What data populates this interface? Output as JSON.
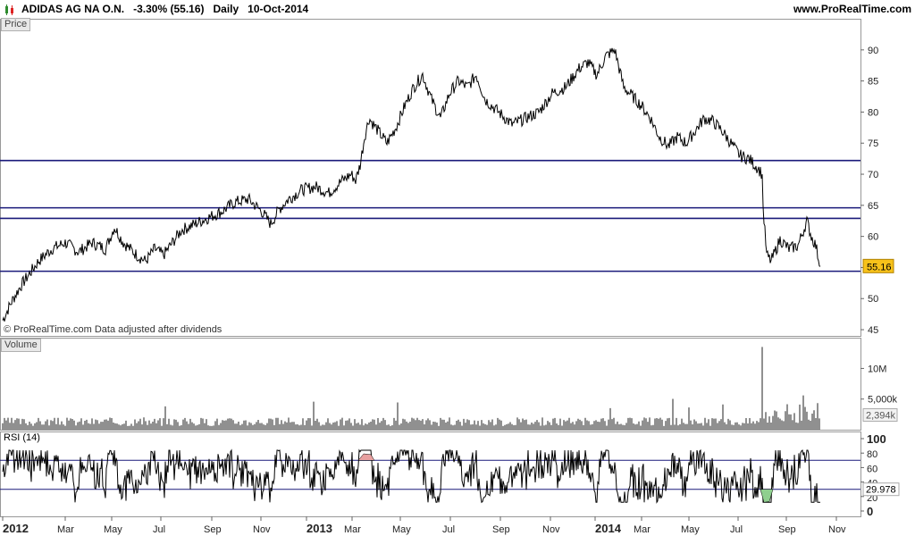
{
  "header": {
    "title": "ADIDAS AG NA O.N.   -3.30% (55.16)   Daily   10-Oct-2014",
    "site": "www.ProRealTime.com"
  },
  "panels": {
    "price_label": "Price",
    "volume_label": "Volume",
    "rsi_label": "RSI (14)"
  },
  "watermark": "© ProRealTime.com  Data adjusted after dividends",
  "colors": {
    "price_line": "#000000",
    "horizontal_lines": "#1a1a7a",
    "last_price_bg": "#f7c21a",
    "rsi_overbought_fill": "#e8a0a0",
    "rsi_oversold_fill": "#8fcf8f"
  },
  "chart_data": [
    {
      "type": "line",
      "panel": "price",
      "ylim": [
        44,
        94
      ],
      "y_ticks": [
        45,
        50,
        55,
        60,
        65,
        70,
        75,
        80,
        85,
        90
      ],
      "last_value_label": "55.16",
      "horizontal_lines": [
        72.2,
        64.6,
        62.9,
        54.4
      ],
      "x_ticks": [
        "2012",
        "Mar",
        "May",
        "Jul",
        "Sep",
        "Nov",
        "2013",
        "Mar",
        "May",
        "Jul",
        "Sep",
        "Nov",
        "2014",
        "Mar",
        "May",
        "Jul",
        "Sep",
        "Nov"
      ],
      "x": [
        0,
        10,
        20,
        30,
        40,
        55,
        70,
        85,
        100,
        115,
        125,
        135,
        150,
        160,
        170,
        180,
        190,
        200,
        215,
        230,
        245,
        260,
        275,
        290,
        300,
        310,
        320,
        335,
        350,
        365,
        380,
        390,
        395,
        400,
        405,
        410,
        420,
        430,
        440,
        450,
        460,
        470,
        480,
        490,
        500,
        510,
        520,
        530,
        540,
        555,
        570,
        585,
        600,
        615,
        630,
        645,
        655,
        665,
        675,
        685,
        695,
        705,
        715,
        725,
        735,
        745,
        755,
        765,
        775,
        785,
        795,
        805,
        815,
        825,
        835,
        845,
        850,
        851,
        855,
        860,
        870,
        880,
        890,
        900,
        905,
        910,
        915
      ],
      "values": [
        46.5,
        49.5,
        52,
        54,
        56,
        58,
        59,
        57.5,
        59,
        58,
        61.5,
        59,
        57,
        56,
        58,
        57,
        59,
        61,
        62,
        63,
        64,
        65.5,
        66,
        64,
        62,
        64.5,
        66,
        67.5,
        68,
        67,
        69,
        70,
        69,
        71.5,
        76,
        79,
        77,
        75,
        77.5,
        81,
        84,
        86,
        82,
        79,
        83,
        85,
        84,
        86,
        82,
        80,
        78,
        79,
        80,
        83,
        84,
        87,
        88,
        86,
        89,
        90,
        84,
        82.5,
        81,
        79,
        76,
        74.5,
        76,
        75,
        77,
        79,
        78.5,
        77,
        75,
        73,
        72.5,
        71,
        70,
        64.5,
        57,
        56,
        59.5,
        58,
        58.5,
        62.5,
        60,
        58.5,
        55.16
      ]
    },
    {
      "type": "bar",
      "panel": "volume",
      "y_ticks": [
        "10M",
        "5,000k"
      ],
      "last_value_label": "2,394k",
      "max": 14,
      "unit": "M"
    },
    {
      "type": "line",
      "panel": "rsi",
      "ylim": [
        0,
        100
      ],
      "y_ticks": [
        0,
        20,
        40,
        60,
        80,
        100
      ],
      "levels": [
        70,
        30
      ],
      "last_value_label": "29.978"
    }
  ]
}
